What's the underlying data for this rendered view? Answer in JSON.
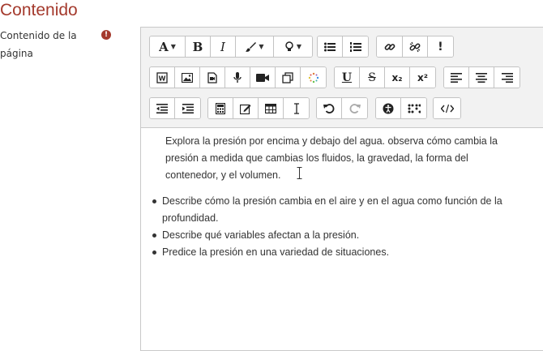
{
  "section": {
    "title": "Contenido"
  },
  "field": {
    "label": "Contenido de la página"
  },
  "toolbar": {
    "rows": [
      [
        [
          "font-style",
          "bold",
          "italic",
          "font-color",
          "background-color"
        ],
        [
          "unordered-list",
          "ordered-list"
        ],
        [
          "link",
          "unlink",
          "special-character"
        ]
      ],
      [
        [
          "word-import",
          "image",
          "media",
          "record-audio",
          "record-video",
          "manage-files",
          "equation-sparkle"
        ],
        [
          "underline",
          "strikethrough",
          "subscript",
          "superscript"
        ],
        [
          "align-left",
          "align-center",
          "align-right"
        ]
      ],
      [
        [
          "outdent",
          "indent"
        ],
        [
          "calculator",
          "edit-rubric",
          "table",
          "text-cursor"
        ],
        [
          "undo",
          "redo"
        ],
        [
          "accessibility-checker",
          "screen-reader-helper"
        ],
        [
          "html-source"
        ]
      ]
    ],
    "text_buttons": {
      "bold": "B",
      "italic": "I",
      "special_char": "!",
      "underline": "U",
      "strike": "S",
      "subscript": "x₂",
      "superscript": "x²"
    }
  },
  "content": {
    "paragraph": "Explora la presión por encima y debajo del agua. observa cómo cambia la presión a medida que cambias los fluidos, la gravedad, la forma del contenedor, y el volumen.",
    "bullets": [
      "Describe cómo la presión cambia en el aire y en el agua como función de la profundidad.",
      "Describe qué variables afectan a la presión.",
      "Predice la presión en una variedad de situaciones."
    ]
  },
  "colors": {
    "accent": "#a43a2d",
    "toolbar_bg": "#f2f2f2",
    "border": "#c9c9c9"
  }
}
